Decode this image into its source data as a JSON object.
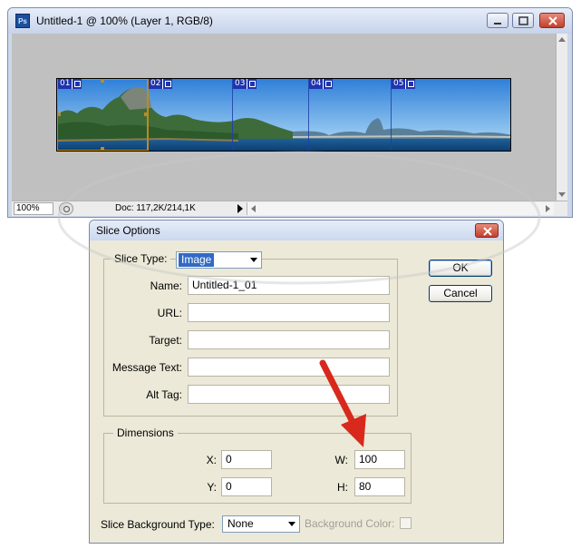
{
  "ps_window": {
    "title": "Untitled-1 @ 100% (Layer 1, RGB/8)",
    "app_icon": "photoshop-icon",
    "status": {
      "zoom": "100%",
      "doc_info": "Doc: 117,2K/214,1K"
    },
    "slices": [
      {
        "num": "01",
        "selected": true
      },
      {
        "num": "02",
        "selected": false
      },
      {
        "num": "03",
        "selected": false
      },
      {
        "num": "04",
        "selected": false
      },
      {
        "num": "05",
        "selected": false
      }
    ]
  },
  "dialog": {
    "title": "Slice Options",
    "slice_type_label": "Slice Type:",
    "slice_type_value": "Image",
    "fields": {
      "name_label": "Name:",
      "name_value": "Untitled-1_01",
      "url_label": "URL:",
      "url_value": "",
      "target_label": "Target:",
      "target_value": "",
      "message_label": "Message Text:",
      "message_value": "",
      "alt_label": "Alt Tag:",
      "alt_value": ""
    },
    "dimensions": {
      "legend": "Dimensions",
      "x_label": "X:",
      "x_value": "0",
      "y_label": "Y:",
      "y_value": "0",
      "w_label": "W:",
      "w_value": "100",
      "h_label": "H:",
      "h_value": "80"
    },
    "bg_type_label": "Slice Background Type:",
    "bg_type_value": "None",
    "bg_color_label": "Background Color:",
    "ok_label": "OK",
    "cancel_label": "Cancel"
  },
  "colors": {
    "annotation_arrow": "#d9281c",
    "slice_tag": "#1f34b0",
    "selected_slice": "#c08a1c"
  }
}
